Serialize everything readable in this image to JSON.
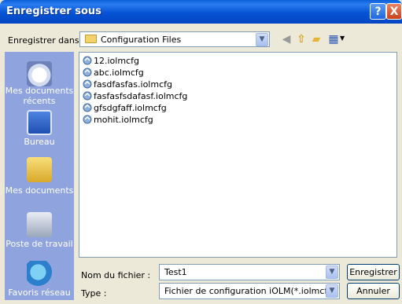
{
  "dialog": {
    "title": "Enregistrer sous"
  },
  "save_in": {
    "label": "Enregistrer dans :",
    "value": "Configuration Files"
  },
  "places": [
    {
      "label": "Mes documents récents"
    },
    {
      "label": "Bureau"
    },
    {
      "label": "Mes documents"
    },
    {
      "label": "Poste de travail"
    },
    {
      "label": "Favoris réseau"
    }
  ],
  "files": [
    "12.iolmcfg",
    "abc.iolmcfg",
    "fasdfasfas.iolmcfg",
    "fasfasfsdafasf.iolmcfg",
    "gfsdgfaff.iolmcfg",
    "mohit.iolmcfg"
  ],
  "file_name": {
    "label": "Nom du fichier :",
    "value": "Test1"
  },
  "file_type": {
    "label": "Type :",
    "value": "Fichier de configuration iOLM(*.iolmcfg)"
  },
  "buttons": {
    "save": "Enregistrer",
    "cancel": "Annuler",
    "help": "?",
    "close": "X"
  },
  "colors": {
    "titlebar": "#0553d4",
    "places_bar": "#8fa4df",
    "dialog_bg": "#ece9d8"
  }
}
